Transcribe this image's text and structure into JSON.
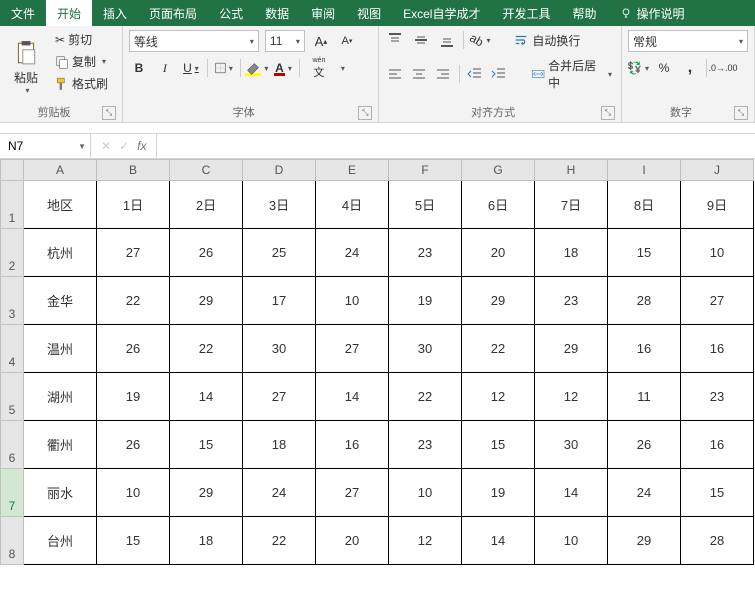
{
  "tabs": {
    "file": "文件",
    "home": "开始",
    "insert": "插入",
    "layout": "页面布局",
    "formulas": "公式",
    "data": "数据",
    "review": "审阅",
    "view": "视图",
    "custom1": "Excel自学成才",
    "dev": "开发工具",
    "help": "帮助",
    "tell_me": "操作说明"
  },
  "ribbon": {
    "clipboard": {
      "paste": "粘贴",
      "cut": "剪切",
      "copy": "复制",
      "format_painter": "格式刷",
      "group": "剪贴板"
    },
    "font": {
      "name": "等线",
      "size": "11",
      "group": "字体",
      "ruby": "wén"
    },
    "alignment": {
      "wrap": "自动换行",
      "merge": "合并后居中",
      "group": "对齐方式"
    },
    "number": {
      "format": "常规",
      "group": "数字"
    }
  },
  "formula_bar": {
    "cell_ref": "N7",
    "fx": "fx"
  },
  "sheet": {
    "col_headers": [
      "A",
      "B",
      "C",
      "D",
      "E",
      "F",
      "G",
      "H",
      "I",
      "J"
    ],
    "row_headers": [
      "1",
      "2",
      "3",
      "4",
      "5",
      "6",
      "7",
      "8"
    ],
    "rows": [
      [
        "地区",
        "1日",
        "2日",
        "3日",
        "4日",
        "5日",
        "6日",
        "7日",
        "8日",
        "9日"
      ],
      [
        "杭州",
        "27",
        "26",
        "25",
        "24",
        "23",
        "20",
        "18",
        "15",
        "10"
      ],
      [
        "金华",
        "22",
        "29",
        "17",
        "10",
        "19",
        "29",
        "23",
        "28",
        "27"
      ],
      [
        "温州",
        "26",
        "22",
        "30",
        "27",
        "30",
        "22",
        "29",
        "16",
        "16"
      ],
      [
        "湖州",
        "19",
        "14",
        "27",
        "14",
        "22",
        "12",
        "12",
        "11",
        "23"
      ],
      [
        "衢州",
        "26",
        "15",
        "18",
        "16",
        "23",
        "15",
        "30",
        "26",
        "16"
      ],
      [
        "丽水",
        "10",
        "29",
        "24",
        "27",
        "10",
        "19",
        "14",
        "24",
        "15"
      ],
      [
        "台州",
        "15",
        "18",
        "22",
        "20",
        "12",
        "14",
        "10",
        "29",
        "28"
      ]
    ]
  },
  "chart_data": {
    "type": "table",
    "title": "",
    "columns": [
      "地区",
      "1日",
      "2日",
      "3日",
      "4日",
      "5日",
      "6日",
      "7日",
      "8日",
      "9日"
    ],
    "rows": [
      {
        "地区": "杭州",
        "1日": 27,
        "2日": 26,
        "3日": 25,
        "4日": 24,
        "5日": 23,
        "6日": 20,
        "7日": 18,
        "8日": 15,
        "9日": 10
      },
      {
        "地区": "金华",
        "1日": 22,
        "2日": 29,
        "3日": 17,
        "4日": 10,
        "5日": 19,
        "6日": 29,
        "7日": 23,
        "8日": 28,
        "9日": 27
      },
      {
        "地区": "温州",
        "1日": 26,
        "2日": 22,
        "3日": 30,
        "4日": 27,
        "5日": 30,
        "6日": 22,
        "7日": 29,
        "8日": 16,
        "9日": 16
      },
      {
        "地区": "湖州",
        "1日": 19,
        "2日": 14,
        "3日": 27,
        "4日": 14,
        "5日": 22,
        "6日": 12,
        "7日": 12,
        "8日": 11,
        "9日": 23
      },
      {
        "地区": "衢州",
        "1日": 26,
        "2日": 15,
        "3日": 18,
        "4日": 16,
        "5日": 23,
        "6日": 15,
        "7日": 30,
        "8日": 26,
        "9日": 16
      },
      {
        "地区": "丽水",
        "1日": 10,
        "2日": 29,
        "3日": 24,
        "4日": 27,
        "5日": 10,
        "6日": 19,
        "7日": 14,
        "8日": 24,
        "9日": 15
      },
      {
        "地区": "台州",
        "1日": 15,
        "2日": 18,
        "3日": 22,
        "4日": 20,
        "5日": 12,
        "6日": 14,
        "7日": 10,
        "8日": 29,
        "9日": 28
      }
    ]
  }
}
